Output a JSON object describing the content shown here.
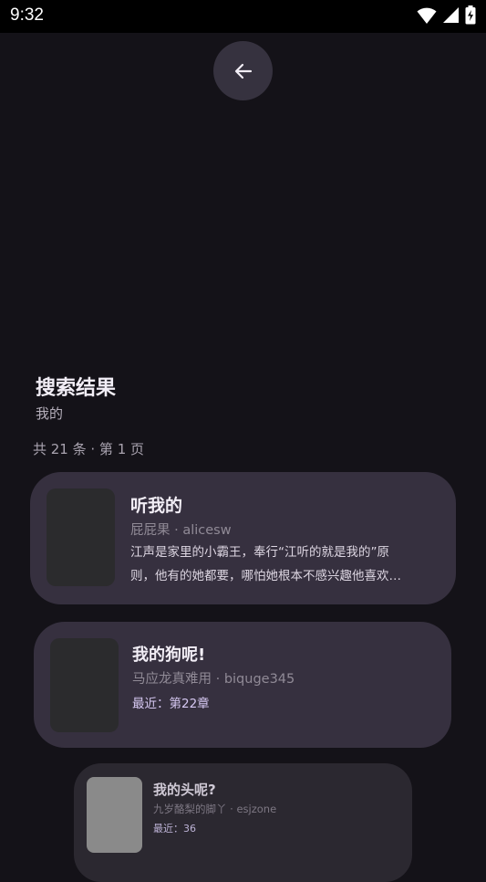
{
  "status_bar": {
    "time": "9:32"
  },
  "page": {
    "heading": "搜索结果",
    "query": "我的",
    "summary": "共 21 条 · 第 1 页"
  },
  "results": [
    {
      "title": "听我的",
      "author": "屁屁果 · alicesw",
      "description_lines": [
        "江声是家里的小霸王，奉行“江听的就是我的”原",
        "则，他有的她都要，哪怕她根本不感兴趣他喜欢…"
      ]
    },
    {
      "title": "我的狗呢!",
      "author": "马应龙真难用 · biquge345",
      "latest": "最近：第22章"
    },
    {
      "title": "我的头呢?",
      "author": "九岁酪梨的脚丫 · esjzone",
      "latest": "最近：36"
    }
  ],
  "colors": {
    "background": "#141218",
    "card": "#36303F",
    "accent": "#D6C8F2"
  }
}
